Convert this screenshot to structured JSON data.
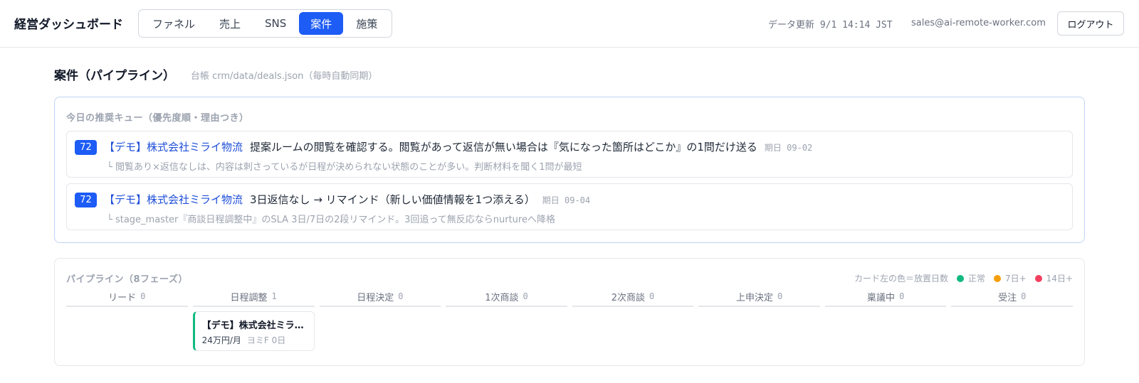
{
  "header": {
    "title": "経営ダッシュボード",
    "tabs": [
      {
        "label": "ファネル",
        "active": false
      },
      {
        "label": "売上",
        "active": false
      },
      {
        "label": "SNS",
        "active": false
      },
      {
        "label": "案件",
        "active": true
      },
      {
        "label": "施策",
        "active": false
      }
    ],
    "updated": "データ更新 9/1 14:14 JST",
    "email": "sales@ai-remote-worker.com",
    "logout_label": "ログアウト"
  },
  "section": {
    "title": "案件（パイプライン）",
    "subtitle": "台帳 crm/data/deals.json（毎時自動同期）"
  },
  "queue": {
    "title": "今日の推奨キュー（優先度順・理由つき）",
    "items": [
      {
        "score": "72",
        "company": "【デモ】株式会社ミライ物流",
        "action": "提案ルームの閲覧を確認する。閲覧があって返信が無い場合は『気になった箇所はどこか』の1問だけ送る",
        "due": "期日 09-02",
        "reason": "└ 閲覧あり×返信なしは、内容は刺さっているが日程が決められない状態のことが多い。判断材料を聞く1問が最短"
      },
      {
        "score": "72",
        "company": "【デモ】株式会社ミライ物流",
        "action": "3日返信なし → リマインド（新しい価値情報を1つ添える）",
        "due": "期日 09-04",
        "reason": "└ stage_master『商談日程調整中』のSLA 3日/7日の2段リマインド。3回追って無反応ならnurtureへ降格"
      }
    ]
  },
  "pipeline": {
    "title": "パイプライン（8フェーズ）",
    "legend": {
      "label": "カード左の色＝放置日数",
      "items": [
        {
          "label": "正常",
          "color": "#10b981"
        },
        {
          "label": "7日+",
          "color": "#f59e0b"
        },
        {
          "label": "14日+",
          "color": "#f43f5e"
        }
      ]
    },
    "columns": [
      {
        "name": "リード",
        "count": "0",
        "cards": []
      },
      {
        "name": "日程調整",
        "count": "1",
        "cards": [
          {
            "name": "【デモ】株式会社ミライ物流",
            "amount": "24万円/月",
            "owner": "ヨミF 0日"
          }
        ]
      },
      {
        "name": "日程決定",
        "count": "0",
        "cards": []
      },
      {
        "name": "1次商談",
        "count": "0",
        "cards": []
      },
      {
        "name": "2次商談",
        "count": "0",
        "cards": []
      },
      {
        "name": "上申決定",
        "count": "0",
        "cards": []
      },
      {
        "name": "稟議中",
        "count": "0",
        "cards": []
      },
      {
        "name": "受注",
        "count": "0",
        "cards": []
      }
    ]
  }
}
